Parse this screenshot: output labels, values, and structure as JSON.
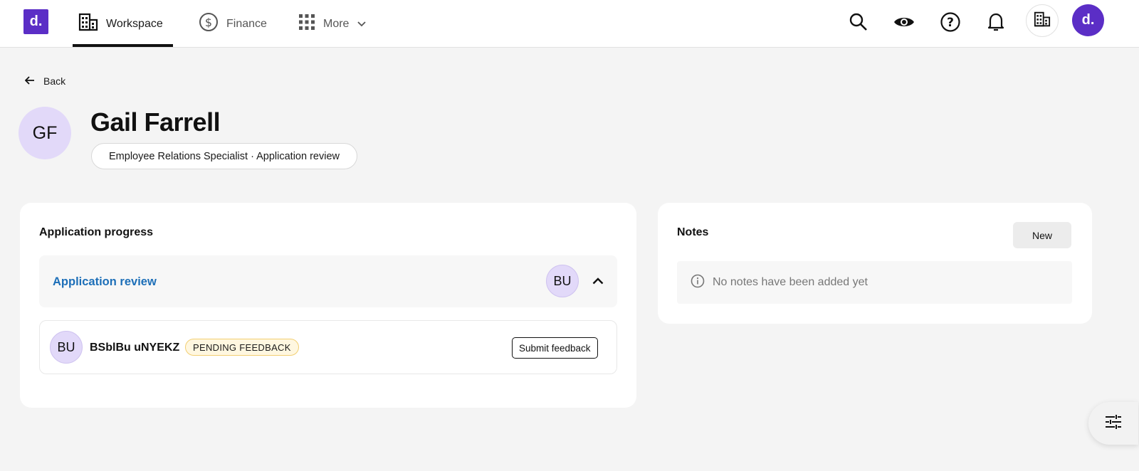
{
  "brand": {
    "logo_text": "d.",
    "accent_color": "#5b2ec6"
  },
  "nav": {
    "items": [
      {
        "label": "Workspace",
        "icon": "building-icon",
        "active": true
      },
      {
        "label": "Finance",
        "icon": "dollar-circle-icon",
        "active": false
      },
      {
        "label": "More",
        "icon": "grid-icon",
        "active": false
      }
    ]
  },
  "top_actions": {
    "icons": [
      "search-icon",
      "eye-icon",
      "help-icon",
      "bell-icon",
      "building-icon"
    ],
    "user_avatar_text": "d."
  },
  "page": {
    "back_label": "Back",
    "profile": {
      "initials": "GF",
      "name": "Gail Farrell",
      "role_stage": "Employee Relations Specialist · Application review"
    }
  },
  "progress": {
    "title": "Application progress",
    "stage": {
      "label": "Application review",
      "assignee_initials": "BU",
      "expanded": true
    },
    "reviewers": [
      {
        "initials": "BU",
        "name": "BSblBu uNYEKZ",
        "status": "PENDING FEEDBACK",
        "action_label": "Submit feedback"
      }
    ]
  },
  "notes": {
    "title": "Notes",
    "new_label": "New",
    "empty_text": "No notes have been added yet"
  },
  "fab": {
    "icon": "sliders-icon"
  }
}
